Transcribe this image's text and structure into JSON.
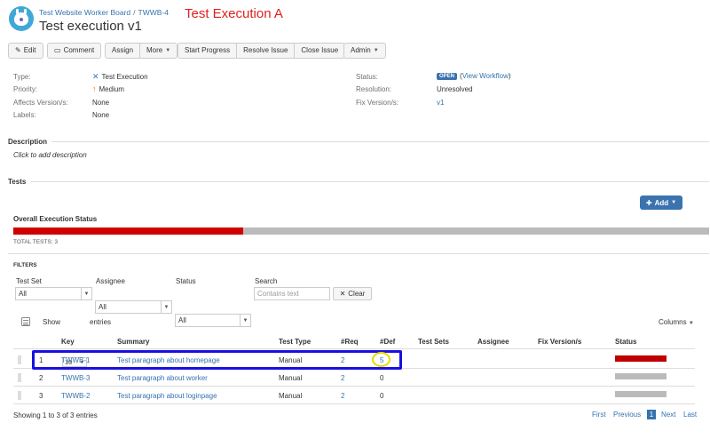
{
  "header": {
    "project_link": "Test Website Worker Board",
    "issue_key_link": "TWWB-4",
    "breadcrumb_sep": "/",
    "title": "Test execution v1",
    "annotation_title": "Test Execution A"
  },
  "toolbar": {
    "edit": "Edit",
    "comment": "Comment",
    "assign": "Assign",
    "more": "More",
    "start_progress": "Start Progress",
    "resolve_issue": "Resolve Issue",
    "close_issue": "Close Issue",
    "admin": "Admin"
  },
  "details": {
    "type_label": "Type:",
    "type_value": "Test Execution",
    "priority_label": "Priority:",
    "priority_value": "Medium",
    "affects_label": "Affects Version/s:",
    "affects_value": "None",
    "labels_label": "Labels:",
    "labels_value": "None",
    "status_label": "Status:",
    "status_badge": "OPEN",
    "status_workflow_open": "(",
    "status_workflow": "View Workflow",
    "status_workflow_close": ")",
    "resolution_label": "Resolution:",
    "resolution_value": "Unresolved",
    "fix_label": "Fix Version/s:",
    "fix_value": "v1"
  },
  "description": {
    "heading": "Description",
    "placeholder": "Click to add description"
  },
  "tests": {
    "heading": "Tests",
    "add_button": "Add",
    "overall_heading": "Overall Execution Status",
    "progress_fraction": 0.33,
    "total_tests": "TOTAL TESTS: 3"
  },
  "filters": {
    "heading": "FILTERS",
    "test_set_label": "Test Set",
    "test_set_value": "All",
    "assignee_label": "Assignee",
    "assignee_value": "All",
    "status_label": "Status",
    "status_value": "All",
    "search_label": "Search",
    "search_placeholder": "Contains text",
    "clear_button": "Clear"
  },
  "table": {
    "show_label": "Show",
    "show_value": "10",
    "entries_label": "entries",
    "columns_button": "Columns",
    "headers": [
      "Key",
      "Summary",
      "Test Type",
      "#Req",
      "#Def",
      "Test Sets",
      "Assignee",
      "Fix Version/s",
      "Status"
    ],
    "rows": [
      {
        "num": "1",
        "key": "TWWB-1",
        "summary": "Test paragraph about homepage",
        "type": "Manual",
        "req": "2",
        "def": "5",
        "status": "fail"
      },
      {
        "num": "2",
        "key": "TWWB-3",
        "summary": "Test paragraph about worker",
        "type": "Manual",
        "req": "2",
        "def": "0",
        "status": "todo"
      },
      {
        "num": "3",
        "key": "TWWB-2",
        "summary": "Test paragraph about loginpage",
        "type": "Manual",
        "req": "2",
        "def": "0",
        "status": "todo"
      }
    ],
    "showing": "Showing 1 to 3 of 3 entries",
    "pager": {
      "first": "First",
      "previous": "Previous",
      "current": "1",
      "next": "Next",
      "last": "Last"
    }
  },
  "colors": {
    "fail": "#c00000",
    "todo": "#bbbbbb",
    "accent": "#3b73af",
    "highlight_box": "#1a10e0",
    "highlight_circle": "#e8d800"
  }
}
